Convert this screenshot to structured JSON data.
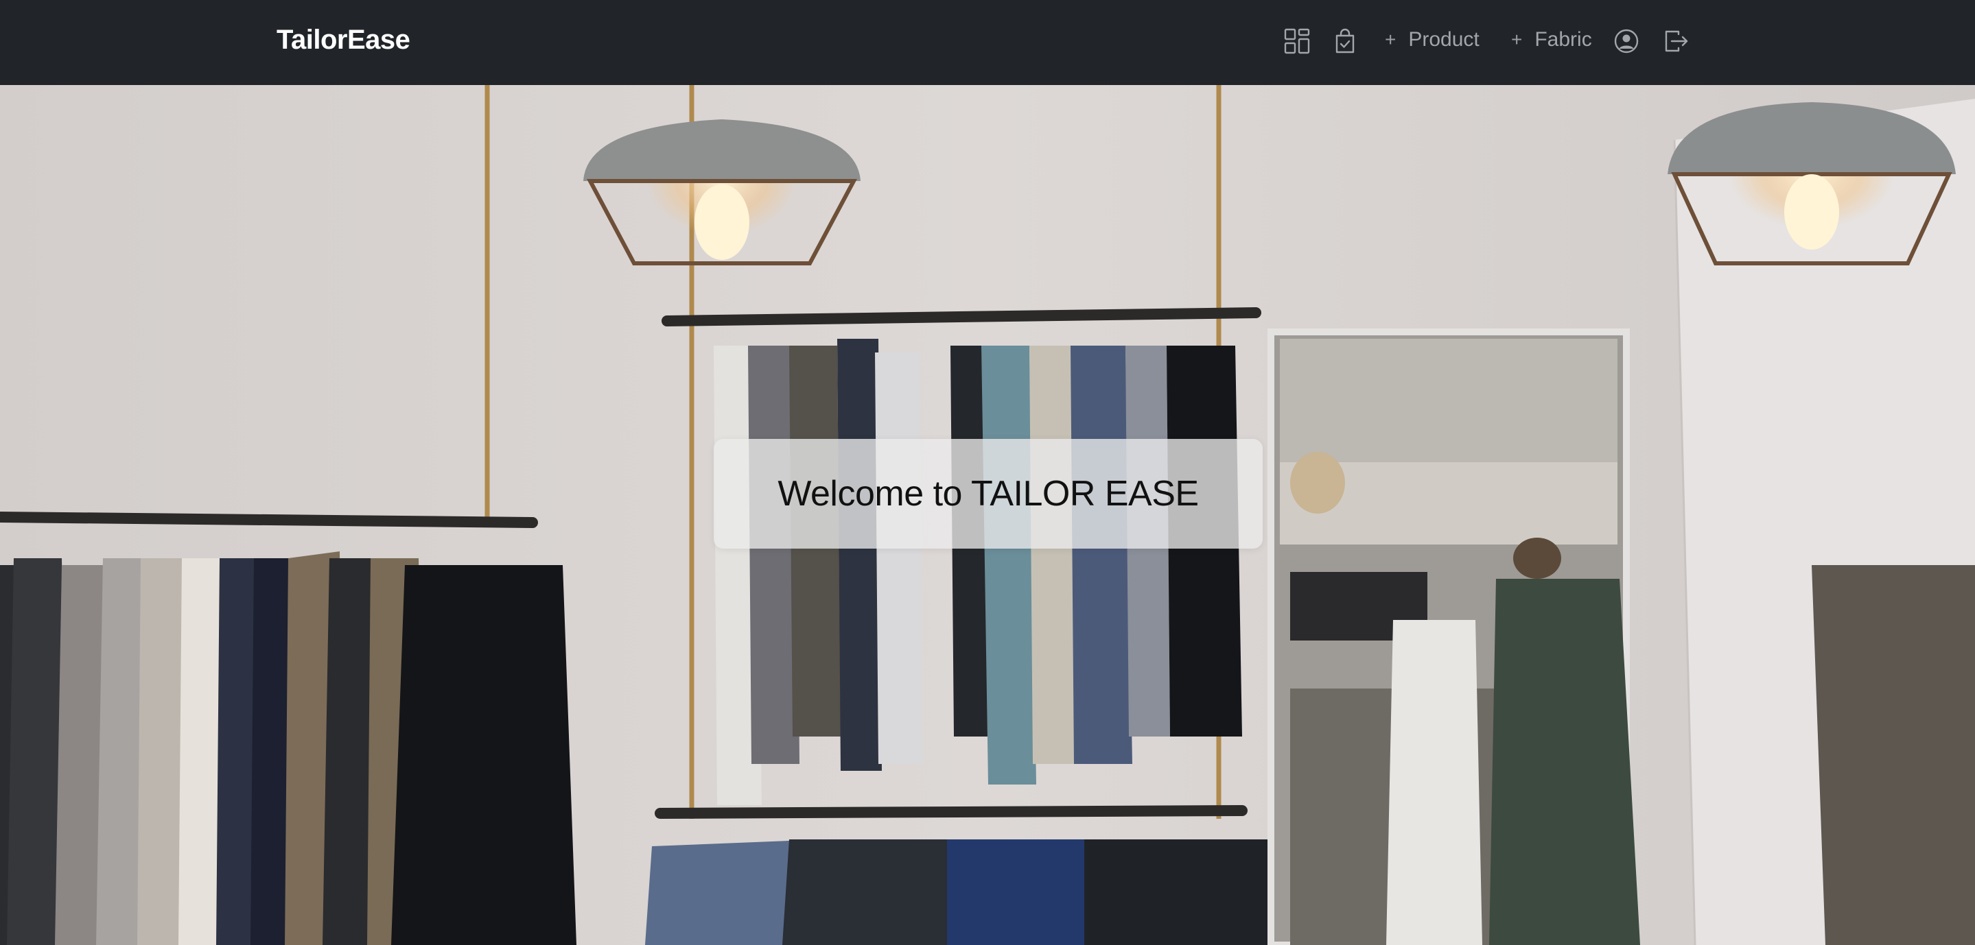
{
  "navbar": {
    "brand": "TailorEase",
    "links": {
      "product": "Product",
      "fabric": "Fabric"
    },
    "icons": {
      "dashboard": "dashboard-icon",
      "orders": "bag-check-icon",
      "plus": "plus-icon",
      "profile": "person-circle-icon",
      "logout": "logout-icon"
    },
    "plus_glyph": "+"
  },
  "hero": {
    "welcome": "Welcome to TAILOR EASE"
  },
  "colors": {
    "navbar_bg": "#212529",
    "brand_text": "#ffffff",
    "nav_link": "#a3a6aa",
    "welcome_box": "#ebebeb"
  }
}
